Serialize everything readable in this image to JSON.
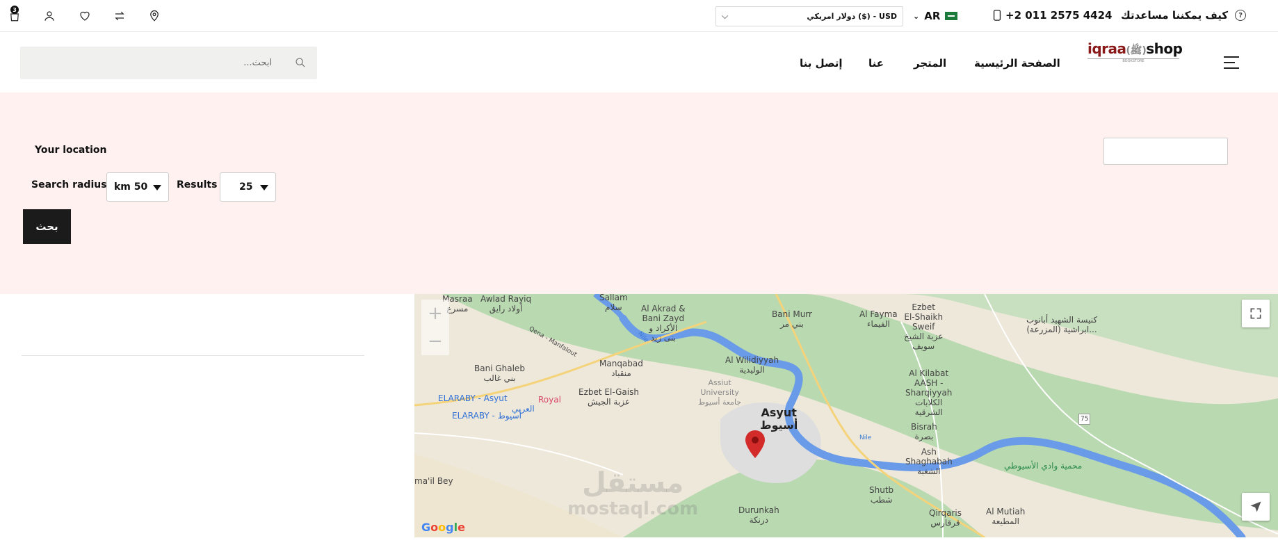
{
  "topbar": {
    "help_text": "كيف يمكننا مساعدتك",
    "phone": "+2 011 2575 4424",
    "language": "AR",
    "currency": "دولار امريكي ($) - USD",
    "cart_count": "3",
    "icons": [
      "cart-icon",
      "user-icon",
      "heart-icon",
      "compare-icon",
      "location-pin-icon"
    ]
  },
  "header": {
    "logo_main": "iqraa",
    "logo_accent": "shop",
    "logo_tagline": "BOOKSTORE",
    "nav": {
      "home": "الصفحة الرئيسية",
      "store": "المتجر",
      "about": "عنا",
      "contact": "إتصل بنا"
    },
    "search_placeholder": "ابحث..."
  },
  "locator": {
    "location_label": "Your location",
    "radius_label": "Search radius",
    "radius_value": "km 50",
    "results_label": "Results",
    "results_value": "25",
    "search_button": "بحث"
  },
  "map": {
    "labels": {
      "masraa": "Masraa",
      "masraa_ar": "مسرع",
      "awlad_rayiq": "Awlad Rayiq",
      "awlad_rayiq_ar": "أولاد رايق",
      "sallam": "Sallam",
      "sallam_ar": "سلام",
      "akrad": "Al Akrad &",
      "bani_zayd": "Bani Zayd",
      "akrad_ar": "الأكراد و",
      "bani_zayd_ar": "بنى زيد",
      "bani_murr": "Bani Murr",
      "bani_murr_ar": "بني مر",
      "al_fayma": "Al Fayma",
      "al_fayma_ar": "الفيماء",
      "ezbet_shaikh": "Ezbet",
      "el_shaikh": "El-Shaikh",
      "sweif": "Sweif",
      "ezbet_shaikh_ar": "عزبة الشيخ",
      "sweif_ar": "سويف",
      "church": "كنيسة الشهيد أبانوب",
      "church2": "(المزرعة) ابراشية...",
      "manqabad": "Manqabad",
      "manqabad_ar": "منقباد",
      "walidiyah": "Al Wilidiyyah",
      "walidiyah_ar": "الوليدية",
      "bani_ghaleb": "Bani Ghaleb",
      "bani_ghaleb_ar": "بني غالب",
      "assiut_univ": "Assiut",
      "assiut_univ2": "University",
      "assiut_univ_ar": "جامعة أسيوط",
      "kilabat": "Al Kilabat",
      "aash": "AASH -",
      "sharqiyyah": "Sharqiyyah",
      "kilabat_ar": "الكلابات",
      "sharqiyyah_ar": "الشرقية",
      "elaraby": "ELARABY - Asyut",
      "elaraby_ar": "العربي",
      "elaraby2": "ELARABY - أسيوط",
      "royal": "Royal",
      "ezbet_gaish": "Ezbet El-Gaish",
      "ezbet_gaish_ar": "عزبة الجيش",
      "asyut": "Asyut",
      "asyut_ar": "أسيوط",
      "bisrah": "Bisrah",
      "bisrah_ar": "بصرة",
      "nile": "Nile",
      "nile2": "Nile",
      "ash": "Ash",
      "shaghabah": "Shaghabah",
      "shaghabah_ar": "الشغبة",
      "reserve": "محمية وادي الأسيوطي",
      "shutb": "Shutb",
      "shutb_ar": "شطب",
      "durunkah": "Durunkah",
      "durunkah_ar": "درنكة",
      "qirqaris": "Qirqaris",
      "qirqaris_ar": "قرقارس",
      "mutiah": "Al Mutiah",
      "mutiah_ar": "المطيعة",
      "mail_bey": "ma'il Bey",
      "road_75": "75",
      "qena": "Qena - Manfalout"
    },
    "watermark": "مستقل",
    "watermark_sub": "mostaql.com",
    "google": [
      "G",
      "o",
      "o",
      "g",
      "l",
      "e"
    ]
  },
  "colors": {
    "accent_panel": "#fff1f0",
    "button": "#1b1b1b",
    "pin": "#d32a2a"
  }
}
